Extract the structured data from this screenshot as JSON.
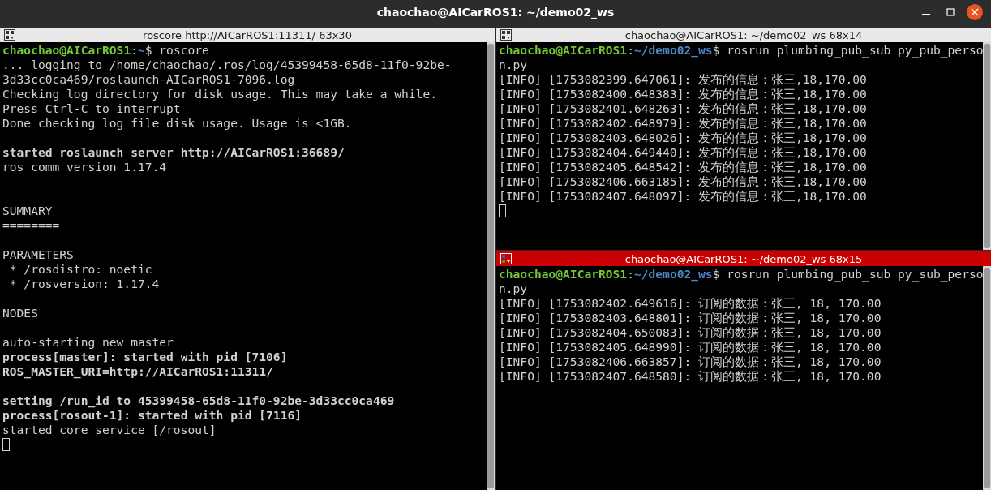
{
  "window": {
    "title": "chaochao@AICarROS1: ~/demo02_ws"
  },
  "panes": [
    {
      "title": "roscore http://AICarROS1:11311/ 63x30",
      "focused": false,
      "lines": [
        {
          "kind": "prompt",
          "user": "chaochao@AICarROS1",
          "separator": ":",
          "path": "~",
          "command": "$ roscore"
        },
        {
          "kind": "text",
          "text": "... logging to /home/chaochao/.ros/log/45399458-65d8-11f0-92be-",
          "bold": false
        },
        {
          "kind": "text",
          "text": "3d33cc0ca469/roslaunch-AICarROS1-7096.log",
          "bold": false
        },
        {
          "kind": "text",
          "text": "Checking log directory for disk usage. This may take a while.",
          "bold": false
        },
        {
          "kind": "text",
          "text": "Press Ctrl-C to interrupt",
          "bold": false
        },
        {
          "kind": "text",
          "text": "Done checking log file disk usage. Usage is <1GB.",
          "bold": false
        },
        {
          "kind": "blank"
        },
        {
          "kind": "text",
          "text": "started roslaunch server http://AICarROS1:36689/",
          "bold": true
        },
        {
          "kind": "text",
          "text": "ros_comm version 1.17.4",
          "bold": false
        },
        {
          "kind": "blank"
        },
        {
          "kind": "blank"
        },
        {
          "kind": "text",
          "text": "SUMMARY",
          "bold": false
        },
        {
          "kind": "text",
          "text": "========",
          "bold": false
        },
        {
          "kind": "blank"
        },
        {
          "kind": "text",
          "text": "PARAMETERS",
          "bold": false
        },
        {
          "kind": "text",
          "text": " * /rosdistro: noetic",
          "bold": false
        },
        {
          "kind": "text",
          "text": " * /rosversion: 1.17.4",
          "bold": false
        },
        {
          "kind": "blank"
        },
        {
          "kind": "text",
          "text": "NODES",
          "bold": false
        },
        {
          "kind": "blank"
        },
        {
          "kind": "text",
          "text": "auto-starting new master",
          "bold": false
        },
        {
          "kind": "text",
          "text": "process[master]: started with pid [7106]",
          "bold": true
        },
        {
          "kind": "text",
          "text": "ROS_MASTER_URI=http://AICarROS1:11311/",
          "bold": true
        },
        {
          "kind": "blank"
        },
        {
          "kind": "text",
          "text": "setting /run_id to 45399458-65d8-11f0-92be-3d33cc0ca469",
          "bold": true
        },
        {
          "kind": "text",
          "text": "process[rosout-1]: started with pid [7116]",
          "bold": true
        },
        {
          "kind": "text",
          "text": "started core service [/rosout]",
          "bold": false
        },
        {
          "kind": "cursor"
        }
      ]
    },
    {
      "title": "chaochao@AICarROS1: ~/demo02_ws 68x14",
      "focused": false,
      "lines": [
        {
          "kind": "prompt",
          "user": "chaochao@AICarROS1",
          "separator": ":",
          "path": "~/demo02_ws",
          "command": "$ rosrun plumbing_pub_sub py_pub_perso"
        },
        {
          "kind": "text",
          "text": "n.py",
          "bold": false
        },
        {
          "kind": "text",
          "text": "[INFO] [1753082399.647061]: 发布的信息：张三,18,170.00",
          "bold": false
        },
        {
          "kind": "text",
          "text": "[INFO] [1753082400.648383]: 发布的信息：张三,18,170.00",
          "bold": false
        },
        {
          "kind": "text",
          "text": "[INFO] [1753082401.648263]: 发布的信息：张三,18,170.00",
          "bold": false
        },
        {
          "kind": "text",
          "text": "[INFO] [1753082402.648979]: 发布的信息：张三,18,170.00",
          "bold": false
        },
        {
          "kind": "text",
          "text": "[INFO] [1753082403.648026]: 发布的信息：张三,18,170.00",
          "bold": false
        },
        {
          "kind": "text",
          "text": "[INFO] [1753082404.649440]: 发布的信息：张三,18,170.00",
          "bold": false
        },
        {
          "kind": "text",
          "text": "[INFO] [1753082405.648542]: 发布的信息：张三,18,170.00",
          "bold": false
        },
        {
          "kind": "text",
          "text": "[INFO] [1753082406.663185]: 发布的信息：张三,18,170.00",
          "bold": false
        },
        {
          "kind": "text",
          "text": "[INFO] [1753082407.648097]: 发布的信息：张三,18,170.00",
          "bold": false
        },
        {
          "kind": "cursor"
        }
      ]
    },
    {
      "title": "chaochao@AICarROS1: ~/demo02_ws 68x15",
      "focused": true,
      "lines": [
        {
          "kind": "prompt",
          "user": "chaochao@AICarROS1",
          "separator": ":",
          "path": "~/demo02_ws",
          "command": "$ rosrun plumbing_pub_sub py_sub_perso"
        },
        {
          "kind": "text",
          "text": "n.py",
          "bold": false
        },
        {
          "kind": "text",
          "text": "[INFO] [1753082402.649616]: 订阅的数据：张三, 18, 170.00",
          "bold": false
        },
        {
          "kind": "text",
          "text": "[INFO] [1753082403.648801]: 订阅的数据：张三, 18, 170.00",
          "bold": false
        },
        {
          "kind": "text",
          "text": "[INFO] [1753082404.650083]: 订阅的数据：张三, 18, 170.00",
          "bold": false
        },
        {
          "kind": "text",
          "text": "[INFO] [1753082405.648990]: 订阅的数据：张三, 18, 170.00",
          "bold": false
        },
        {
          "kind": "text",
          "text": "[INFO] [1753082406.663857]: 订阅的数据：张三, 18, 170.00",
          "bold": false
        },
        {
          "kind": "text",
          "text": "[INFO] [1753082407.648580]: 订阅的数据：张三, 18, 170.00",
          "bold": false
        }
      ]
    }
  ]
}
